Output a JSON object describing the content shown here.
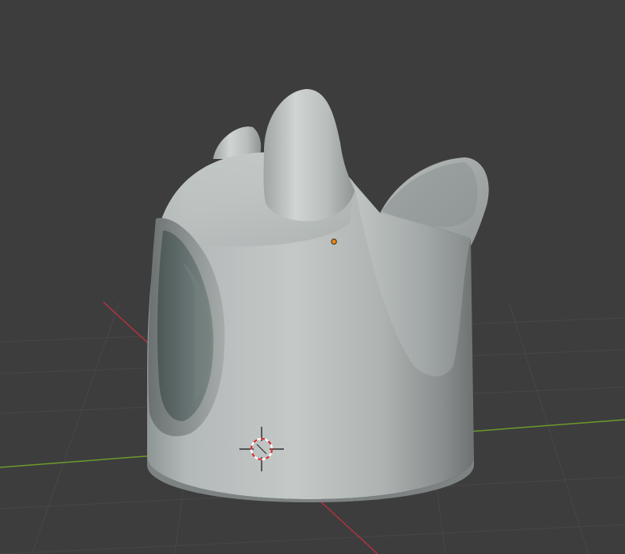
{
  "viewport": {
    "editor": "3D Viewport",
    "background_color": "#3d3d3d",
    "grid_line_color": "#474747",
    "x_axis_color": "#b0333f",
    "y_axis_color": "#6b9a2a",
    "object_color": "#b8bdbd",
    "origin_color": "#e88a14",
    "cursor_ring_colors": [
      "#d43030",
      "#ffffff"
    ],
    "object": {
      "name": "mesh-object",
      "shape": "sculpted-cylinder-with-cutouts"
    },
    "icons": {
      "cursor": "3d-cursor-icon",
      "origin": "object-origin-icon"
    }
  }
}
